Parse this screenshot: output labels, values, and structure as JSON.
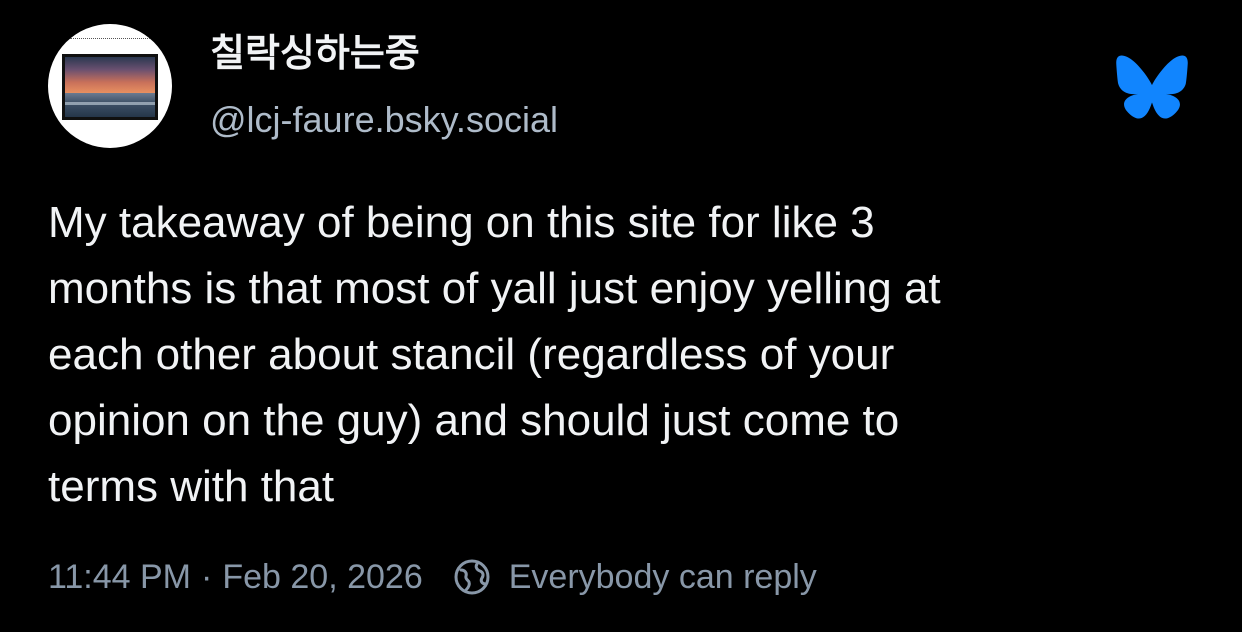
{
  "author": {
    "display_name": "칠락싱하는중",
    "handle": "@lcj-faure.bsky.social",
    "avatar_icon": "avatar-image"
  },
  "brand": {
    "logo_icon": "butterfly-icon",
    "accent_color": "#1185fe"
  },
  "post": {
    "lines": [
      "My takeaway of being on this site for like 3",
      "months is that most of yall just enjoy yelling at",
      "each other about stancil (regardless of your",
      "opinion on the guy) and should just come to",
      "terms with that"
    ]
  },
  "footer": {
    "time": "11:44 PM",
    "separator": "·",
    "date": "Feb 20, 2026",
    "reply_setting": "Everybody can reply",
    "reply_icon": "globe-icon"
  },
  "colors": {
    "background": "#000000",
    "text": "#f1f3f5",
    "muted": "#8897a8"
  }
}
